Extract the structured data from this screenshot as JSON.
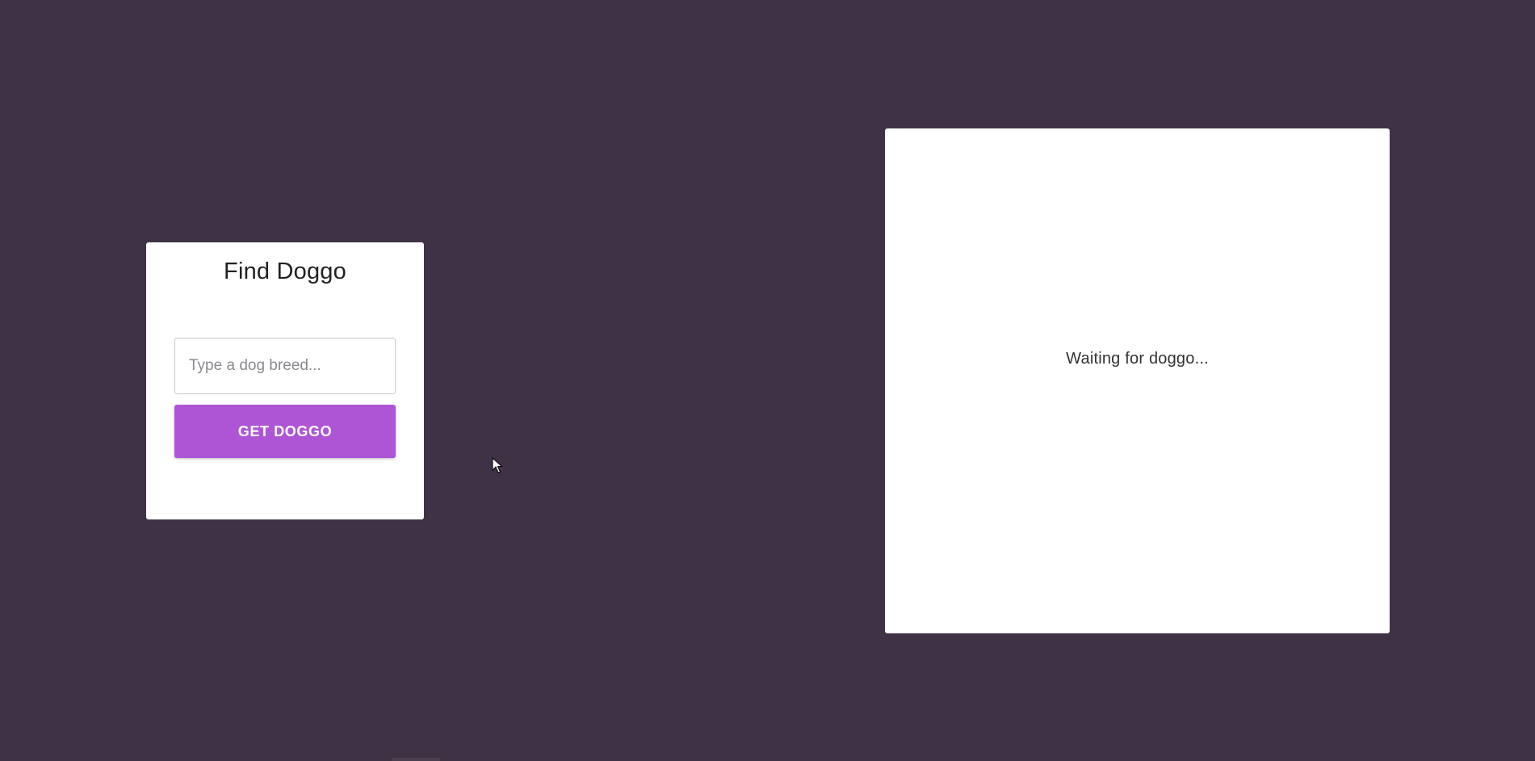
{
  "search_card": {
    "title": "Find Doggo",
    "input_placeholder": "Type a dog breed...",
    "input_value": "",
    "button_label": "GET DOGGO"
  },
  "result_card": {
    "status_text": "Waiting for doggo..."
  },
  "colors": {
    "background": "#3f3244",
    "card": "#ffffff",
    "accent": "#ae55d6"
  },
  "icons": {
    "cursor": "mouse-pointer-icon"
  }
}
